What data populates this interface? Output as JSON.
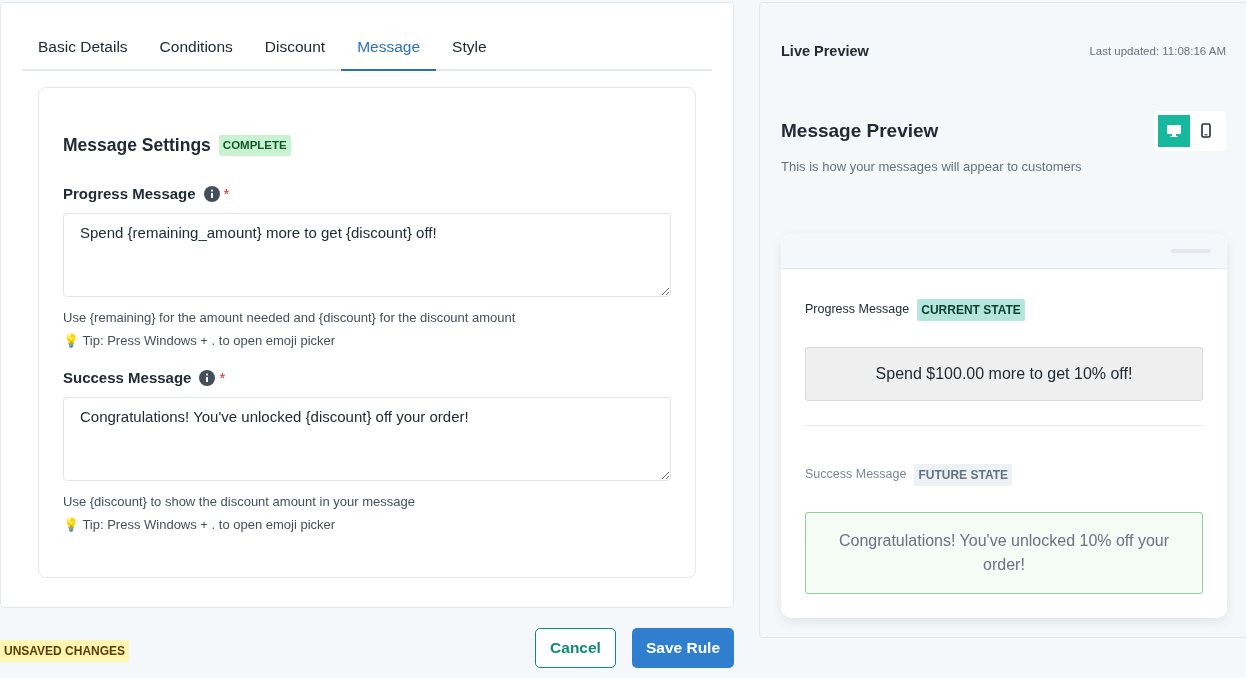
{
  "tabs": [
    {
      "label": "Basic Details",
      "selected": false
    },
    {
      "label": "Conditions",
      "selected": false
    },
    {
      "label": "Discount",
      "selected": false
    },
    {
      "label": "Message",
      "selected": true
    },
    {
      "label": "Style",
      "selected": false
    }
  ],
  "settings": {
    "title": "Message Settings",
    "status": "COMPLETE",
    "fields": [
      {
        "label": "Progress Message",
        "required": "*",
        "value": "Spend {remaining_amount} more to get {discount} off!",
        "help": "Use {remaining} for the amount needed and {discount} for the discount amount",
        "tip": "💡 Tip: Press Windows + . to open emoji picker"
      },
      {
        "label": "Success Message",
        "required": "*",
        "value": "Congratulations! You've unlocked {discount} off your order!",
        "help": "Use {discount} to show the discount amount in your message",
        "tip": "💡 Tip: Press Windows + . to open emoji picker"
      }
    ]
  },
  "footer": {
    "unsaved": "UNSAVED CHANGES",
    "buttons": [
      {
        "label": "Cancel",
        "kind": "outline"
      },
      {
        "label": "Save Rule",
        "kind": "primary"
      }
    ]
  },
  "preview": {
    "title": "Live Preview",
    "updated": "Last updated: 11:08:16 AM",
    "heading": "Message Preview",
    "subtitle": "This is how your messages will appear to customers",
    "devices": [
      {
        "kind": "desktop",
        "selected": true
      },
      {
        "kind": "mobile",
        "selected": false
      }
    ],
    "messages": [
      {
        "label": "Progress Message",
        "state": "CURRENT STATE",
        "kind": "current",
        "text": "Spend $100.00 more to get 10% off!"
      },
      {
        "label": "Success Message",
        "state": "FUTURE STATE",
        "kind": "future",
        "text": "Congratulations! You've unlocked 10% off your order!"
      }
    ]
  }
}
